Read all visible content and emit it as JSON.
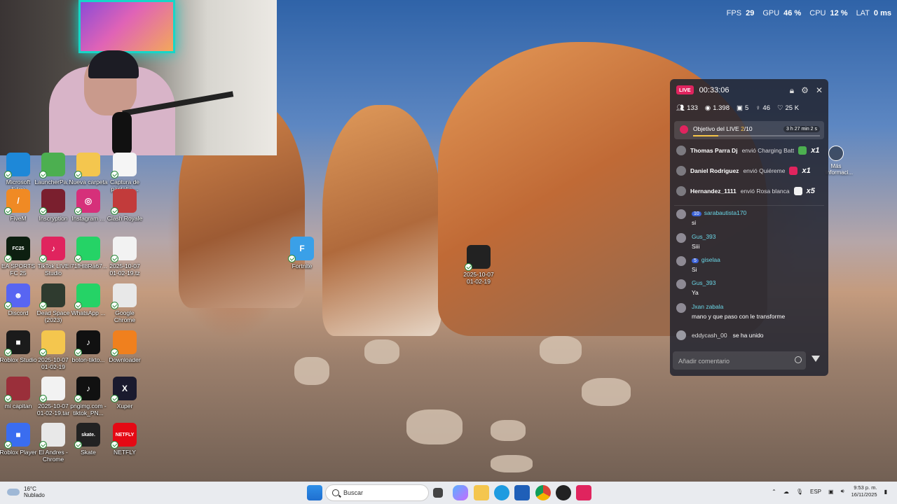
{
  "overlay": {
    "fps_label": "FPS",
    "fps_value": "29",
    "gpu_label": "GPU",
    "gpu_value": "46 %",
    "cpu_label": "CPU",
    "cpu_value": "12 %",
    "lat_label": "LAT",
    "lat_value": "0 ms"
  },
  "desktop_icons": [
    {
      "label": "Microsoft Edge",
      "color": "#1e88d8"
    },
    {
      "label": "LauncherPa...",
      "color": "#4caf50"
    },
    {
      "label": "Nueva carpeta",
      "color": "#f4c64e"
    },
    {
      "label": "Captura de pantalla ...",
      "color": "#f5f5f5"
    },
    {
      "label": "FiveM",
      "color": "#f08a24"
    },
    {
      "label": "Inscryption",
      "color": "#7a1f2e"
    },
    {
      "label": "Instagram ...",
      "color": "#d6307a"
    },
    {
      "label": "Clash Royale",
      "color": "#c23b3b"
    },
    {
      "label": "EA SPORTS FC 25",
      "color": "#0d1f10"
    },
    {
      "label": "TikTok LIVE Studio",
      "color": "#e0245e"
    },
    {
      "label": "i71fHl8Ra67...",
      "color": "#25d366"
    },
    {
      "label": "2025-10-07 01-02-19.tz",
      "color": "#f2f2f2"
    },
    {
      "label": "Discord",
      "color": "#5865f2"
    },
    {
      "label": "Dead Space (2023)",
      "color": "#2f3b2f"
    },
    {
      "label": "WhatsApp ...",
      "color": "#25d366"
    },
    {
      "label": "Google Chrome",
      "color": "#e8e8e8"
    },
    {
      "label": "Roblox Studio",
      "color": "#1b1b1b"
    },
    {
      "label": "2025-10-07 01-02-19",
      "color": "#f4c64e"
    },
    {
      "label": "boton-tikto...",
      "color": "#111"
    },
    {
      "label": "Downloader",
      "color": "#f0801e"
    },
    {
      "label": "mi capitan",
      "color": "#9a2f3a"
    },
    {
      "label": "2025-10-07 01-02-19.tar",
      "color": "#f2f2f2"
    },
    {
      "label": "pngimg.com - tiktok_PN...",
      "color": "#111"
    },
    {
      "label": "Xuper",
      "color": "#1a1a2e"
    },
    {
      "label": "Roblox Player",
      "color": "#3a6df0"
    },
    {
      "label": "El Andres - Chrome",
      "color": "#e8e8e8"
    },
    {
      "label": "Skate",
      "color": "#222"
    },
    {
      "label": "NETFLY",
      "color": "#e50914"
    },
    {
      "label": "Fortnite",
      "color": "#3aa0e8"
    },
    {
      "label": "2025-10-07 01-02-19",
      "color": "#222"
    }
  ],
  "icon_glyphs": {
    "fivem": "/",
    "instagram": "◎",
    "discord": "☻",
    "roblox": "■",
    "tiktok": "♪",
    "fortnite": "F",
    "netfly": "NETFLY",
    "skate": "skate.",
    "xuper": "X",
    "ea": "FC25"
  },
  "live": {
    "badge": "LIVE",
    "timer": "00:33:06",
    "stats": {
      "viewers": "133",
      "views": "1.398",
      "gifts": "5",
      "followers": "46",
      "likes": "25 K"
    },
    "goal": {
      "title_prefix": "Objetivo del LIVE",
      "current": "2",
      "total": "/10",
      "time_left": "3 h 27 min 2 s",
      "progress": 0.2
    },
    "gifts": [
      {
        "user": "Thomas Parra Dj",
        "action": "envió Charging Batt",
        "count": "x1",
        "color": "#4caf50"
      },
      {
        "user": "Daniel Rodriguez",
        "action": "envió Quiéreme",
        "count": "x1",
        "color": "#e0245e"
      },
      {
        "user": "Hernandez_1111",
        "action": "envió Rosa blanca",
        "count": "x5",
        "color": "#f1f1f1"
      }
    ],
    "messages": [
      {
        "level": "10",
        "user": "sarabautista170",
        "text": "si"
      },
      {
        "level": "",
        "user": "Gus_393",
        "text": "Siii"
      },
      {
        "level": "5",
        "user": "giselaa",
        "text": "Si"
      },
      {
        "level": "",
        "user": "Gus_393",
        "text": "Ya"
      },
      {
        "level": "",
        "user": "Jxan zabala",
        "text": "mano y que paso con le transforme"
      }
    ],
    "joined_user": "eddycash_00",
    "joined_text": "se ha unido",
    "comment_placeholder": "Añadir comentario"
  },
  "more_info_label": "Más informaci...",
  "taskbar": {
    "weather_temp": "16°C",
    "weather_desc": "Nublado",
    "search_placeholder": "Buscar",
    "lang": "ESP",
    "time": "9:53 p. m.",
    "date": "16/11/2025"
  }
}
